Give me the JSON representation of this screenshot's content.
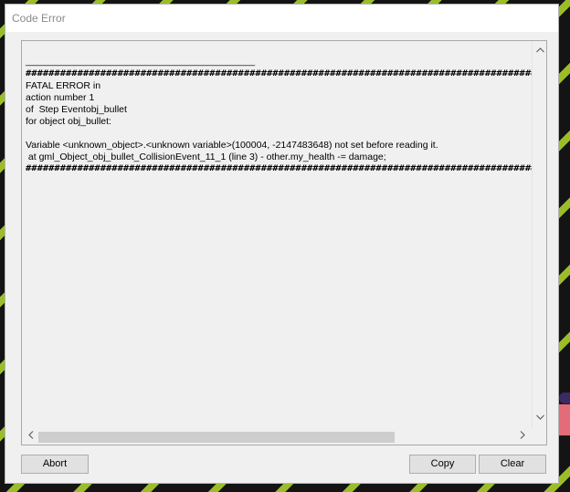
{
  "window": {
    "title": "Code Error"
  },
  "error": {
    "lines": [
      "___________________________________________",
      "############################################################################################",
      "FATAL ERROR in",
      "action number 1",
      "of  Step Eventobj_bullet",
      "for object obj_bullet:",
      "",
      "Variable <unknown_object>.<unknown variable>(100004, -2147483648) not set before reading it.",
      " at gml_Object_obj_bullet_CollisionEvent_11_1 (line 3) - other.my_health -= damage;",
      "############################################################################################"
    ]
  },
  "scroll": {
    "up_icon": "scroll-up-icon",
    "down_icon": "scroll-down-icon",
    "left_icon": "scroll-left-icon",
    "right_icon": "scroll-right-icon"
  },
  "buttons": {
    "abort_label": "Abort",
    "copy_label": "Copy",
    "clear_label": "Clear"
  }
}
